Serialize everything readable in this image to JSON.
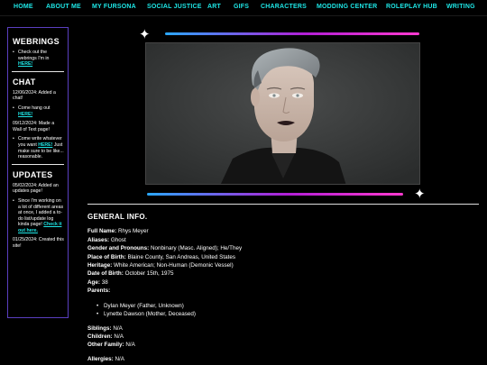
{
  "nav": [
    "HOME",
    "ABOUT ME",
    "MY FURSONA",
    "SOCIAL JUSTICE",
    "ART",
    "GIFS",
    "CHARACTERS",
    "MODDING CENTER",
    "ROLEPLAY HUB",
    "WRITING"
  ],
  "sidebar": {
    "webrings": {
      "title": "WEBRINGS",
      "item_text": "Check out the webrings I'm in",
      "item_link": "HERE!"
    },
    "chat": {
      "title": "CHAT",
      "update1": "12/06/2024: Added a chat!",
      "item_text": "Come hang out",
      "item_link": "HERE!",
      "update2": "09/12/2024: Made a Wall of Text page!",
      "item2_text": "Come write whatever you want",
      "item2_link": "HERE!",
      "item2_tail": "Just make sure to be like... reasonable."
    },
    "updates": {
      "title": "UPDATES",
      "update1": "05/02/2024: Added an updates page!",
      "item_text": "Since I'm working on a lot of different areas at once, I added a to-do list/update log kinda page!",
      "item_link": "Check it out here.",
      "update2": "01/25/2024: Created this site!"
    }
  },
  "colors": {
    "nav_link": "#1ee6e6",
    "sidebar_border": "#5a3fc0",
    "bar_gradient": [
      "#2aa8ff",
      "#b21fd6",
      "#ff3ad0"
    ]
  },
  "icons": [
    "sparkle-star-icon",
    "sparkle-star-icon"
  ],
  "content": {
    "heading": "GENERAL INFO.",
    "full_name": {
      "label": "Full Name:",
      "value": "Rhys Meyer"
    },
    "aliases": {
      "label": "Aliases:",
      "value": "Ghost"
    },
    "gender": {
      "label": "Gender and Pronouns:",
      "value": "Nonbinary (Masc. Aligned); He/They"
    },
    "pob": {
      "label": "Place of Birth:",
      "value": "Blaine County, San Andreas, United States"
    },
    "heritage": {
      "label": "Heritage:",
      "value": "White American; Non-Human (Demonic Vessel)"
    },
    "dob": {
      "label": "Date of Birth:",
      "value": "October 15th, 1975"
    },
    "age": {
      "label": "Age:",
      "value": "38"
    },
    "parents": {
      "label": "Parents:",
      "items": [
        "Dylan Meyer (Father, Unknown)",
        "Lynette Dawson (Mother, Deceased)"
      ]
    },
    "siblings": {
      "label": "Siblings:",
      "value": "N/A"
    },
    "children": {
      "label": "Children:",
      "value": "N/A"
    },
    "other_family": {
      "label": "Other Family:",
      "value": "N/A"
    },
    "allergies": {
      "label": "Allergies:",
      "value": "N/A"
    }
  }
}
